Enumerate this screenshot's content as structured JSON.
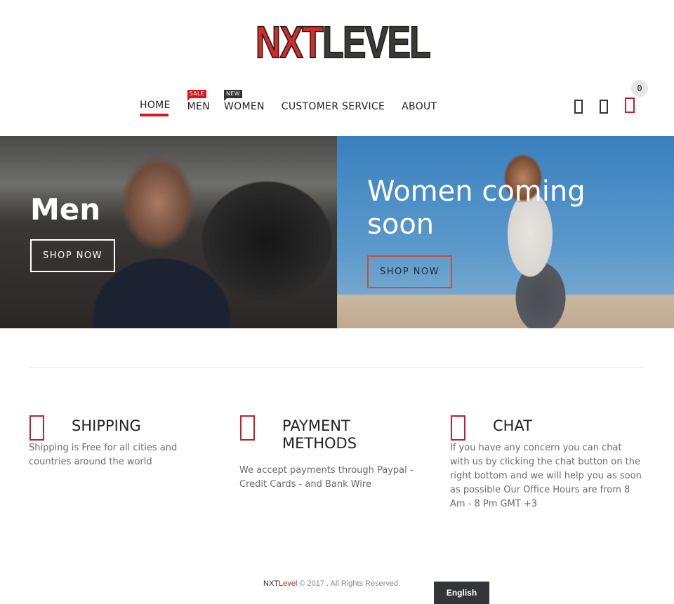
{
  "header": {
    "logo": {
      "part1": "NXT",
      "part2": "LEVEL"
    },
    "nav": [
      {
        "label": "HOME",
        "active": true
      },
      {
        "label": "MEN",
        "badge": "SALE"
      },
      {
        "label": "WOMEN",
        "badge": "NEW"
      },
      {
        "label": "CUSTOMER SERVICE"
      },
      {
        "label": "ABOUT"
      }
    ],
    "icons": [
      "search-icon",
      "account-icon",
      "cart-icon"
    ],
    "cart_count": "0",
    "colors": {
      "accent": "#d0191e",
      "text": "#222222"
    }
  },
  "banners": [
    {
      "title": "Men",
      "button": "SHOP NOW"
    },
    {
      "title": "Women coming soon",
      "button": "SHOP NOW"
    }
  ],
  "features": [
    {
      "icon": "shipping-icon",
      "title": "SHIPPING",
      "text": "Shipping is Free for all cities and countries around the world"
    },
    {
      "icon": "payment-icon",
      "title": "PAYMENT METHODS",
      "text": "We accept payments through Paypal - Credit Cards - and  Bank Wire"
    },
    {
      "icon": "chat-icon",
      "title": "CHAT",
      "text": "If you have any concern you can chat with us by clicking the chat button on the right bottom and we will help you as soon as possible Our Office Hours are from 8 Am - 8 Pm GMT +3"
    }
  ],
  "footer": {
    "brand1": "NXT",
    "brand2": "Level",
    "copyright": " © 2017 . All Rights Reserved.",
    "language": "English"
  }
}
